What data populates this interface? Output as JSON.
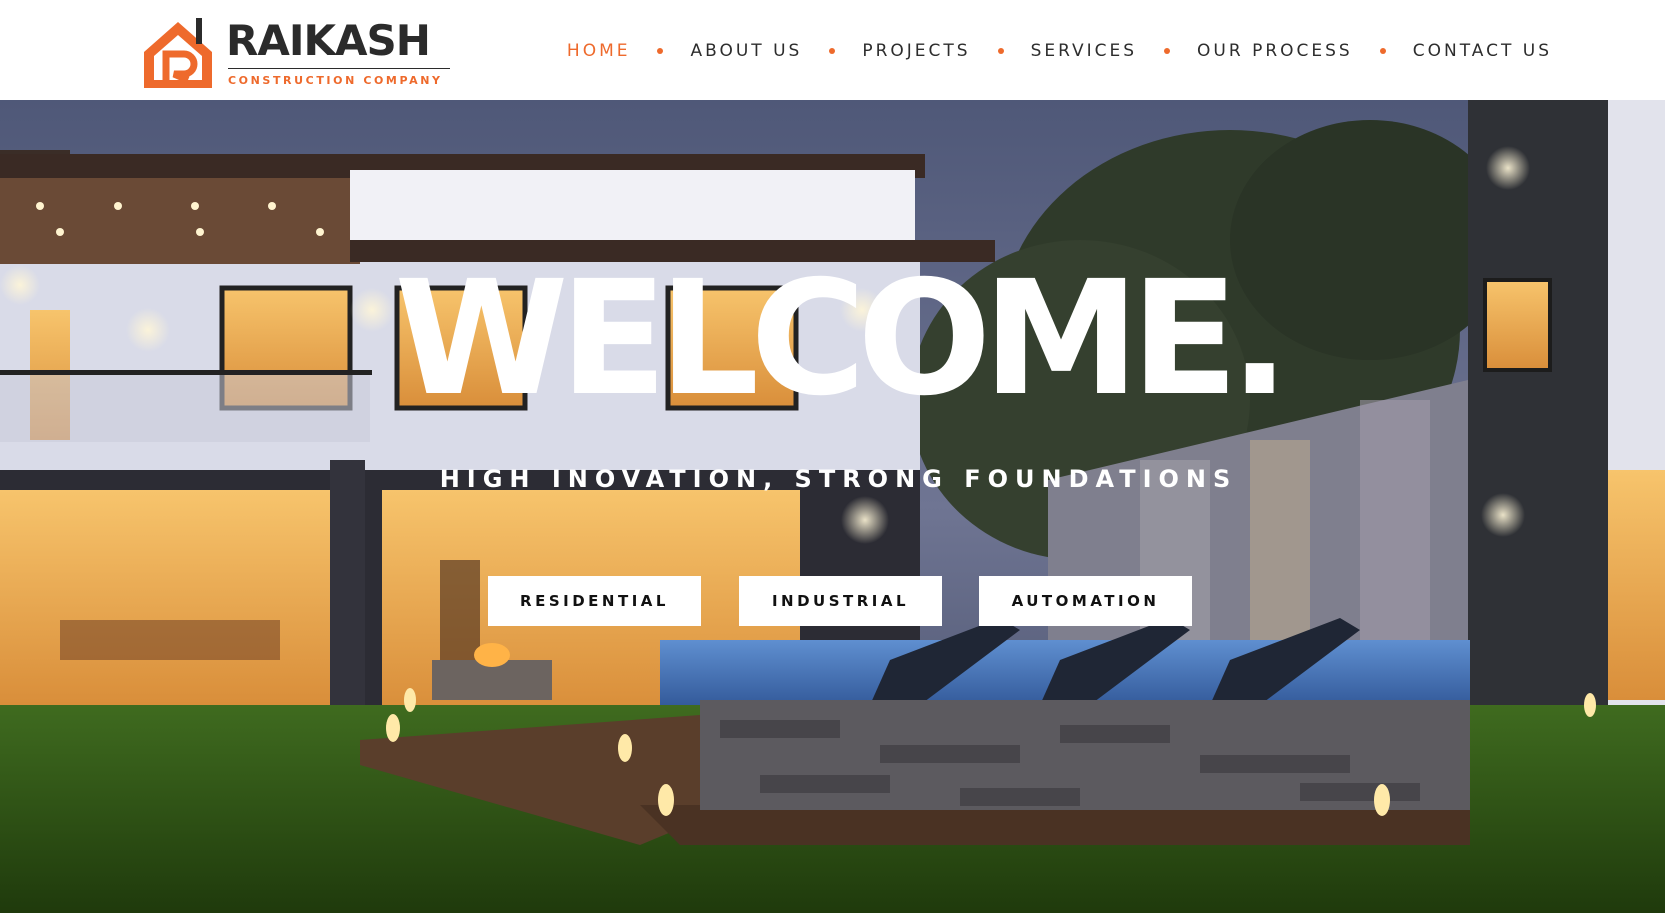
{
  "brand": {
    "name": "RAIKASH",
    "tagline": "CONSTRUCTION COMPANY",
    "logo_icon": "house-icon",
    "accent_color": "#ee6a2c",
    "dark_color": "#2b2b2b"
  },
  "nav": {
    "items": [
      {
        "label": "HOME",
        "active": true
      },
      {
        "label": "ABOUT US",
        "active": false
      },
      {
        "label": "PROJECTS",
        "active": false
      },
      {
        "label": "SERVICES",
        "active": false
      },
      {
        "label": "OUR PROCESS",
        "active": false
      },
      {
        "label": "CONTACT US",
        "active": false
      }
    ]
  },
  "hero": {
    "title": "WELCOME.",
    "subtitle": "HIGH INOVATION, STRONG FOUNDATIONS",
    "buttons": [
      {
        "label": "RESIDENTIAL"
      },
      {
        "label": "INDUSTRIAL"
      },
      {
        "label": "AUTOMATION"
      }
    ]
  }
}
